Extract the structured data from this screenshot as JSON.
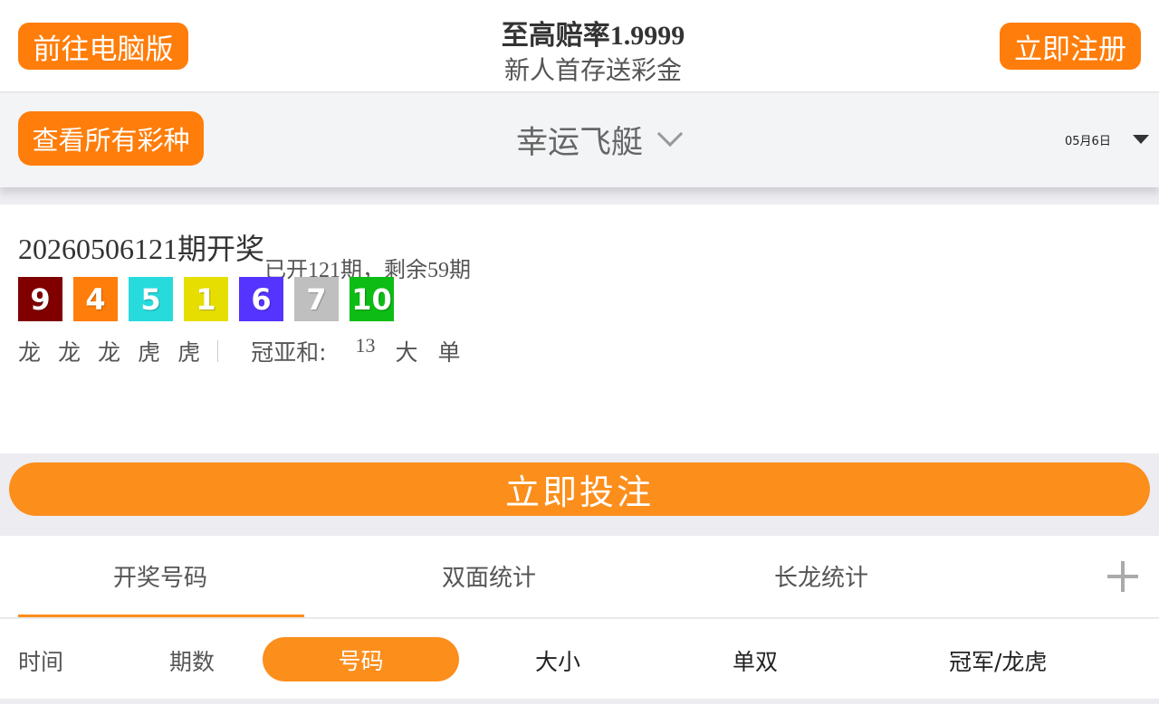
{
  "header": {
    "pc_button": "前往电脑版",
    "title": "至高赔率1.9999",
    "subtitle": "新人首存送彩金",
    "register_button": "立即注册"
  },
  "game_bar": {
    "all_games_button": "查看所有彩种",
    "game_name": "幸运飞艇",
    "date": "05月6日"
  },
  "result": {
    "period_main": "20260506121期开奖",
    "period_sub": "已开121期，剩余59期",
    "balls": [
      {
        "value": "9",
        "color": "#800000"
      },
      {
        "value": "4",
        "color": "#ff7d0a"
      },
      {
        "value": "5",
        "color": "#27dbdd"
      },
      {
        "value": "1",
        "color": "#e6de00"
      },
      {
        "value": "6",
        "color": "#5534ff"
      },
      {
        "value": "7",
        "color": "#bfbfbf"
      },
      {
        "value": "10",
        "color": "#0dbc14"
      }
    ],
    "dragon_tiger": [
      "龙",
      "龙",
      "龙",
      "虎",
      "虎"
    ],
    "sum_label": "冠亚和:",
    "sum_value": "13",
    "size": "大",
    "parity": "单"
  },
  "bet_button": "立即投注",
  "tabs": [
    "开奖号码",
    "双面统计",
    "长龙统计"
  ],
  "active_tab": "开奖号码",
  "filters": {
    "time": "时间",
    "period": "期数",
    "number": "号码",
    "size": "大小",
    "parity": "单双",
    "champion": "冠军/龙虎"
  },
  "colors": {
    "accent": "#fc8e1c",
    "button_orange": "#ff7d0a"
  }
}
